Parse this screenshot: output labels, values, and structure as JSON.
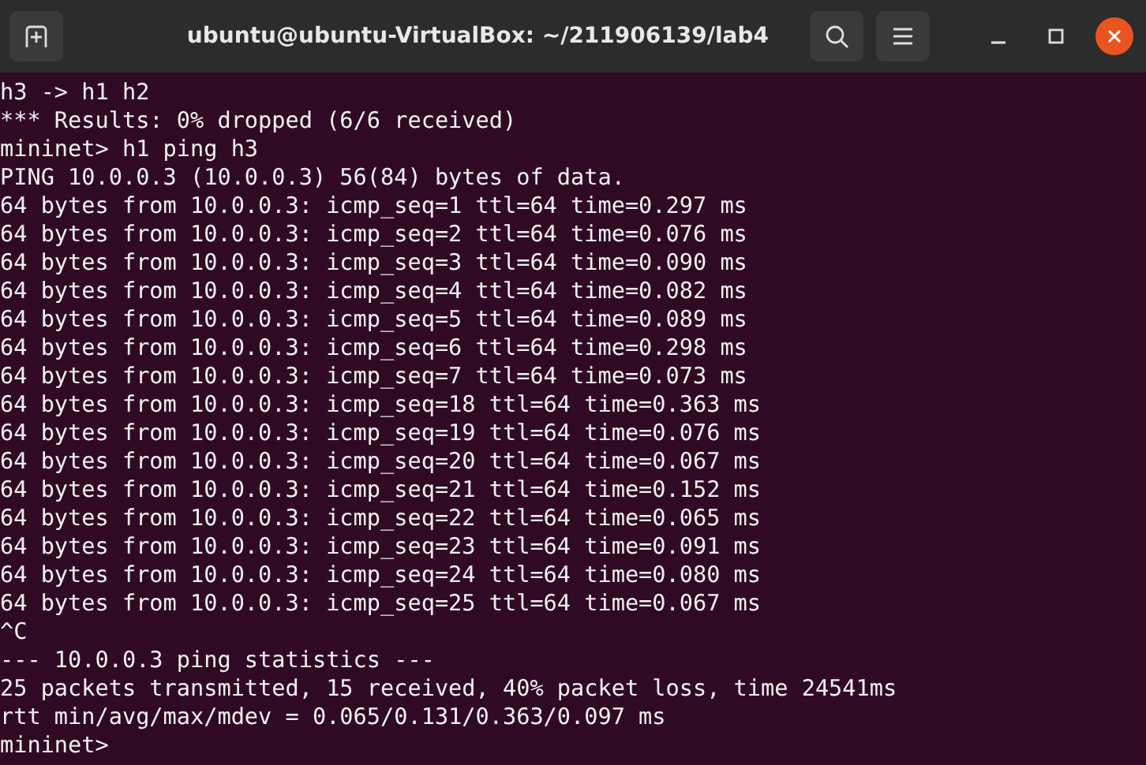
{
  "window": {
    "title": "ubuntu@ubuntu-VirtualBox: ~/211906139/lab4"
  },
  "terminal": {
    "lines": [
      "h3 -> h1 h2",
      "*** Results: 0% dropped (6/6 received)",
      "mininet> h1 ping h3",
      "PING 10.0.0.3 (10.0.0.3) 56(84) bytes of data.",
      "64 bytes from 10.0.0.3: icmp_seq=1 ttl=64 time=0.297 ms",
      "64 bytes from 10.0.0.3: icmp_seq=2 ttl=64 time=0.076 ms",
      "64 bytes from 10.0.0.3: icmp_seq=3 ttl=64 time=0.090 ms",
      "64 bytes from 10.0.0.3: icmp_seq=4 ttl=64 time=0.082 ms",
      "64 bytes from 10.0.0.3: icmp_seq=5 ttl=64 time=0.089 ms",
      "64 bytes from 10.0.0.3: icmp_seq=6 ttl=64 time=0.298 ms",
      "64 bytes from 10.0.0.3: icmp_seq=7 ttl=64 time=0.073 ms",
      "64 bytes from 10.0.0.3: icmp_seq=18 ttl=64 time=0.363 ms",
      "64 bytes from 10.0.0.3: icmp_seq=19 ttl=64 time=0.076 ms",
      "64 bytes from 10.0.0.3: icmp_seq=20 ttl=64 time=0.067 ms",
      "64 bytes from 10.0.0.3: icmp_seq=21 ttl=64 time=0.152 ms",
      "64 bytes from 10.0.0.3: icmp_seq=22 ttl=64 time=0.065 ms",
      "64 bytes from 10.0.0.3: icmp_seq=23 ttl=64 time=0.091 ms",
      "64 bytes from 10.0.0.3: icmp_seq=24 ttl=64 time=0.080 ms",
      "64 bytes from 10.0.0.3: icmp_seq=25 ttl=64 time=0.067 ms",
      "^C",
      "--- 10.0.0.3 ping statistics ---",
      "25 packets transmitted, 15 received, 40% packet loss, time 24541ms",
      "rtt min/avg/max/mdev = 0.065/0.131/0.363/0.097 ms",
      "mininet>"
    ]
  }
}
